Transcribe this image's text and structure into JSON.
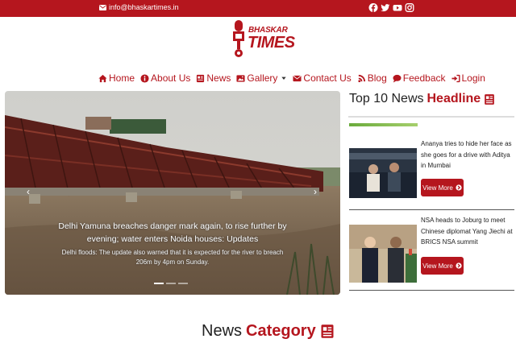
{
  "topbar": {
    "email": "info@bhaskartimes.in",
    "social": [
      "facebook-icon",
      "twitter-icon",
      "youtube-icon",
      "instagram-icon"
    ]
  },
  "logo": {
    "line1": "BHASKAR",
    "line2": "TIMES"
  },
  "nav": {
    "items": [
      {
        "label": "Home",
        "icon": "home-icon"
      },
      {
        "label": "About Us",
        "icon": "info-icon"
      },
      {
        "label": "News",
        "icon": "newspaper-icon"
      },
      {
        "label": "Gallery",
        "icon": "image-icon"
      },
      {
        "label": "Contact Us",
        "icon": "envelope-icon"
      },
      {
        "label": "Blog",
        "icon": "blog-icon"
      },
      {
        "label": "Feedback",
        "icon": "comment-icon"
      },
      {
        "label": "Login",
        "icon": "login-icon"
      }
    ]
  },
  "slider": {
    "title": "Delhi Yamuna breaches danger mark again, to rise further by evening; water enters Noida houses: Updates",
    "subtitle": "Delhi floods: The update also warned that it is expected for the river to breach 206m by 4pm on Sunday."
  },
  "sidebar": {
    "title_plain": "Top 10 News",
    "title_highlight": "Headline",
    "items": [
      {
        "title": "Ananya tries to hide her face as she goes for a drive with Aditya in Mumbai",
        "button": "View More"
      },
      {
        "title": "NSA heads to Joburg to meet Chinese diplomat Yang Jiechi at BRICS NSA summit",
        "button": "View More"
      }
    ]
  },
  "section": {
    "title_plain": "News",
    "title_highlight": "Category"
  },
  "colors": {
    "brand": "#b5161e"
  }
}
